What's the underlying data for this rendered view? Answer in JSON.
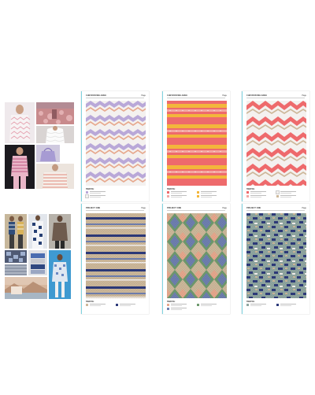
{
  "colors": {
    "card_accent": "#7fd3e0",
    "lavender": "#b9a8d8",
    "white_stitch": "#f4f1ef",
    "peach": "#e7a88d",
    "coral": "#ee6a6c",
    "pink": "#f4a6a2",
    "yellow": "#f3b63b",
    "beige": "#cdb89a",
    "navy": "#2d3a7a",
    "denim": "#6f7fb0",
    "sage": "#8fa6a0",
    "green": "#6f9a6e"
  },
  "moodboard_top": {
    "photos": [
      "lace-knit-top",
      "pink-field",
      "white-ruffle-top",
      "lilac-bag",
      "striped-outfit",
      "striped-cardigan"
    ]
  },
  "moodboard_bottom": {
    "photos": [
      "runway-stripes",
      "patterned-suit",
      "blue-coat",
      "blue-pattern-runway",
      "fabric-closeup",
      "textile-stack",
      "mountain-lake",
      "blue-knit-look"
    ]
  },
  "cards_top": [
    {
      "title": "CHEVRON MELANGE",
      "page": "Page",
      "label": "SWATCH",
      "legend_colors": [
        "#b9a8d8",
        "#f4f1ef",
        "#e7a88d",
        "#ee6a6c"
      ]
    },
    {
      "title": "CHEVRON MELANGE",
      "page": "Page",
      "label": "SWATCH",
      "legend_colors": [
        "#ee6a6c",
        "#f3b63b",
        "#f4a6a2",
        "#f4f1ef"
      ]
    },
    {
      "title": "CHEVRON MELANGE",
      "page": "Page",
      "label": "SWATCH",
      "legend_colors": [
        "#ee6a6c",
        "#f4f1ef",
        "#f4a6a2",
        "#cdb89a"
      ]
    }
  ],
  "cards_bottom": [
    {
      "title": "PROJECT ONE",
      "page": "Page",
      "label": "SWATCH",
      "legend_colors": [
        "#cdb89a",
        "#2d3a7a",
        "#6f7fb0",
        "#f4f1ef"
      ]
    },
    {
      "title": "PROJECT ONE",
      "page": "Page",
      "label": "SWATCH",
      "legend_colors": [
        "#e7a88d",
        "#6f9a6e",
        "#6f7fb0",
        "#cdb89a"
      ]
    },
    {
      "title": "PROJECT ONE",
      "page": "Page",
      "label": "SWATCH",
      "legend_colors": [
        "#8fa6a0",
        "#2d3a7a",
        "#cdb89a",
        "#f4f1ef"
      ]
    }
  ]
}
